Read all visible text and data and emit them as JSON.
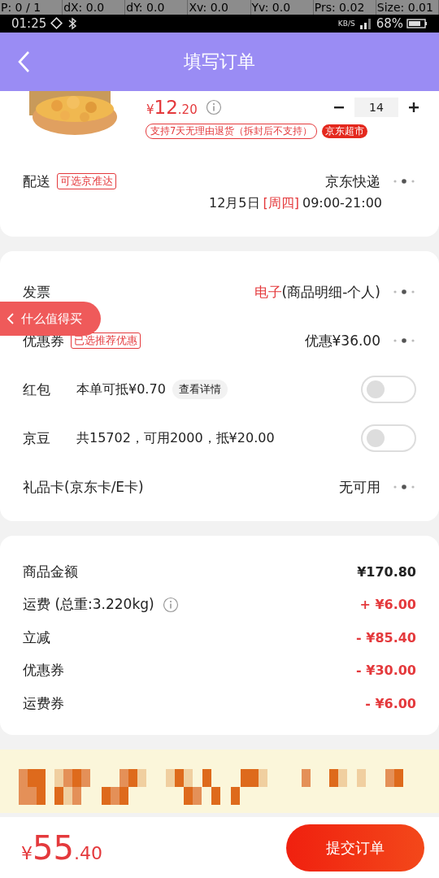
{
  "debug_overlay": [
    "P: 0 / 1",
    "dX: 0.0",
    "dY: 0.0",
    "Xv: 0.0",
    "Yv: 0.0",
    "Prs: 0.02",
    "Size: 0.01"
  ],
  "status_bar": {
    "time": "01:25",
    "net_speed": "KB/S",
    "battery": "68%"
  },
  "header": {
    "title": "填写订单"
  },
  "product": {
    "price": {
      "currency": "¥",
      "integer": "12",
      "decimal": ".20"
    },
    "return_policy": "支持7天无理由退货（拆封后不支持）",
    "store_tag": "京东超市",
    "quantity": "14"
  },
  "delivery": {
    "label": "配送",
    "tag": "可选京准达",
    "carrier": "京东快递",
    "date": "12月5日",
    "weekday": "[周四]",
    "time": "09:00-21:00"
  },
  "options": [
    {
      "kind": "link",
      "label": "发票",
      "value_highlight": "电子",
      "value": "(商品明细-个人)"
    },
    {
      "kind": "link",
      "label": "优惠券",
      "tag": "已选推荐优惠",
      "value": "优惠¥36.00"
    },
    {
      "kind": "toggle",
      "label": "红包",
      "desc": "本单可抵¥0.70",
      "detail": "查看详情",
      "on": false
    },
    {
      "kind": "toggle",
      "label": "京豆",
      "desc": "共15702，可用2000，抵¥20.00",
      "on": false
    },
    {
      "kind": "link",
      "label": "礼品卡(京东卡/E卡)",
      "value": "无可用"
    }
  ],
  "floating_badge": "什么值得买",
  "totals": [
    {
      "kind": "subtotal",
      "label": "商品金额",
      "value": "¥170.80"
    },
    {
      "kind": "adjustment",
      "label": "运费 (总重:3.220kg)",
      "info": true,
      "value": "+ ¥6.00"
    },
    {
      "kind": "adjustment",
      "label": "立减",
      "value": "- ¥85.40"
    },
    {
      "kind": "adjustment",
      "label": "优惠券",
      "value": "- ¥30.00"
    },
    {
      "kind": "adjustment",
      "label": "运费券",
      "value": "- ¥6.00"
    }
  ],
  "footer": {
    "total": {
      "currency": "¥",
      "integer": "55",
      "decimal": ".40"
    },
    "submit": "提交订单"
  }
}
